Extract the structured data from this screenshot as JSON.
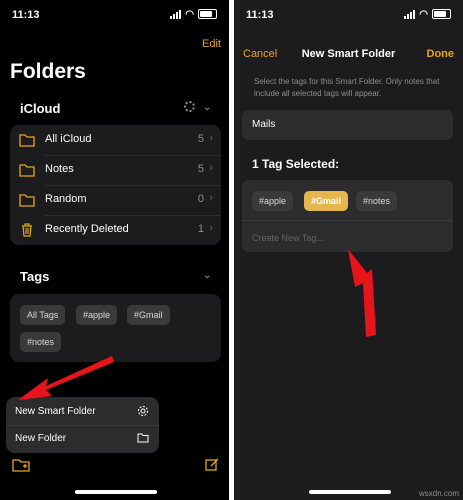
{
  "left": {
    "status_time": "11:13",
    "edit_label": "Edit",
    "title": "Folders",
    "icloud_header": "iCloud",
    "folders": [
      {
        "icon": "folder-icon",
        "label": "All iCloud",
        "count": "5"
      },
      {
        "icon": "folder-icon",
        "label": "Notes",
        "count": "5"
      },
      {
        "icon": "folder-icon",
        "label": "Random",
        "count": "0"
      },
      {
        "icon": "trash-icon",
        "label": "Recently Deleted",
        "count": "1"
      }
    ],
    "tags_header": "Tags",
    "tags": [
      "All Tags",
      "#apple",
      "#Gmail",
      "#notes"
    ],
    "menu": [
      {
        "label": "New Smart Folder",
        "icon": "gear-icon"
      },
      {
        "label": "New Folder",
        "icon": "folder-icon"
      }
    ]
  },
  "right": {
    "status_time": "11:13",
    "cancel_label": "Cancel",
    "title": "New Smart Folder",
    "done_label": "Done",
    "hint": "Select the tags for this Smart Folder. Only notes that include all selected tags will appear.",
    "folder_name": "Mails",
    "selected_header": "1 Tag Selected:",
    "tags": [
      {
        "label": "#apple",
        "selected": false
      },
      {
        "label": "#Gmail",
        "selected": true
      },
      {
        "label": "#notes",
        "selected": false
      }
    ],
    "create_placeholder": "Create New Tag..."
  },
  "watermark": "wsxdn.com",
  "colors": {
    "accent": "#e5a51c",
    "selected_tag": "#e5b64d",
    "arrow": "#e8141c"
  }
}
